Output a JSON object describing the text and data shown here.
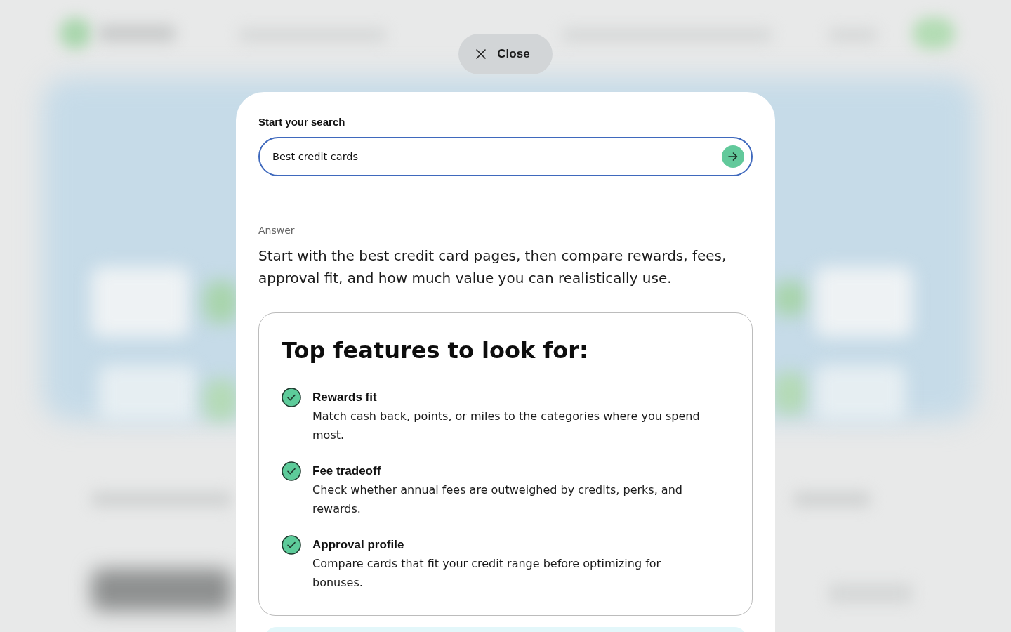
{
  "close_button": {
    "label": "Close"
  },
  "search": {
    "label": "Start your search",
    "value": "Best credit cards"
  },
  "answer": {
    "label": "Answer",
    "text": "Start with the best credit card pages, then compare rewards, fees, approval fit, and how much value you can realistically use."
  },
  "features": {
    "title": "Top features to look for:",
    "items": [
      {
        "title": "Rewards fit",
        "description": "Match cash back, points, or miles to the categories where you spend most."
      },
      {
        "title": "Fee tradeoff",
        "description": "Check whether annual fees are outweighed by credits, perks, and rewards."
      },
      {
        "title": "Approval profile",
        "description": "Compare cards that fit your credit range before optimizing for bonuses."
      }
    ]
  }
}
